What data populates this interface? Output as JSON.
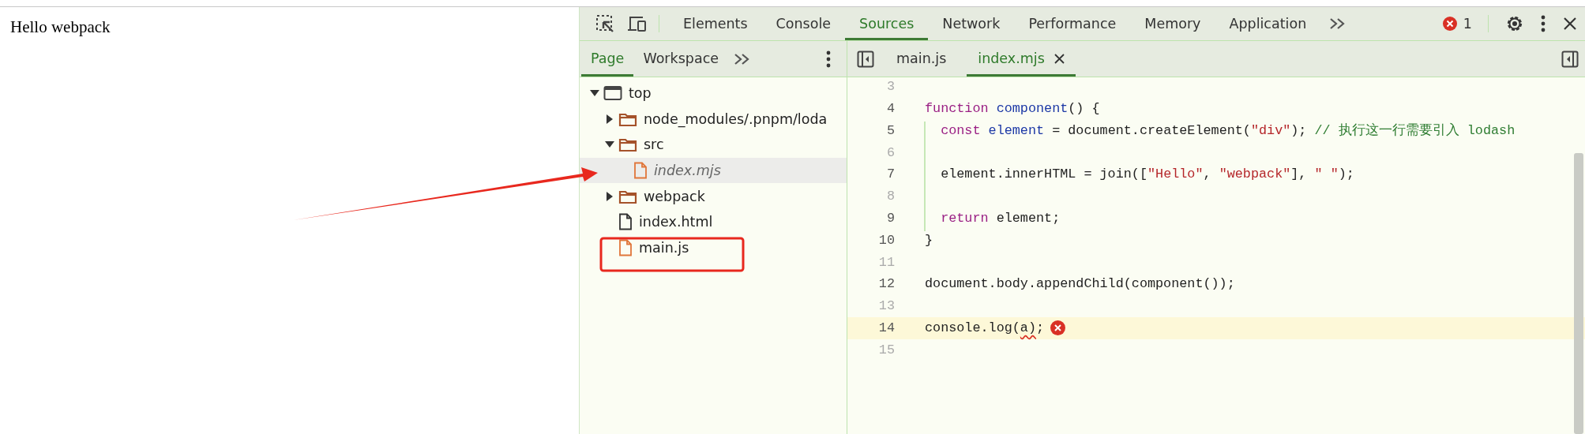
{
  "page": {
    "text": "Hello webpack"
  },
  "devtools": {
    "panel_tabs": [
      {
        "label": "Elements",
        "selected": false
      },
      {
        "label": "Console",
        "selected": false
      },
      {
        "label": "Sources",
        "selected": true
      },
      {
        "label": "Network",
        "selected": false
      },
      {
        "label": "Performance",
        "selected": false
      },
      {
        "label": "Memory",
        "selected": false
      },
      {
        "label": "Application",
        "selected": false
      }
    ],
    "error_count": "1",
    "navigator_tabs": [
      {
        "label": "Page",
        "selected": true
      },
      {
        "label": "Workspace",
        "selected": false
      }
    ],
    "file_tree": [
      {
        "label": "top",
        "kind": "frame",
        "expanded": true,
        "selected": false,
        "children": [
          {
            "label": "node_modules/.pnpm/loda",
            "kind": "folder",
            "expanded": false,
            "selected": false
          },
          {
            "label": "src",
            "kind": "folder",
            "expanded": true,
            "selected": false,
            "children": [
              {
                "label": "index.mjs",
                "kind": "script",
                "selected": true
              }
            ]
          },
          {
            "label": "webpack",
            "kind": "folder",
            "expanded": false,
            "selected": false
          },
          {
            "label": "index.html",
            "kind": "document",
            "selected": false
          },
          {
            "label": "main.js",
            "kind": "script",
            "selected": false
          }
        ]
      }
    ],
    "editor_tabs": [
      {
        "label": "main.js",
        "selected": false,
        "closable": false
      },
      {
        "label": "index.mjs",
        "selected": true,
        "closable": true
      }
    ],
    "code_lines": [
      {
        "number": "3",
        "highlighted": false,
        "error": false
      },
      {
        "number": "4",
        "highlighted": false,
        "error": false,
        "tokens": [
          {
            "kind": "keyword",
            "text": "function "
          },
          {
            "kind": "def",
            "text": "component"
          },
          {
            "kind": "plain",
            "text": "() {"
          }
        ]
      },
      {
        "number": "5",
        "highlighted": false,
        "error": false,
        "tokens": [
          {
            "kind": "keyword",
            "text": "  const "
          },
          {
            "kind": "def",
            "text": "element"
          },
          {
            "kind": "plain",
            "text": " = document.createElement("
          },
          {
            "kind": "string",
            "text": "\"div\""
          },
          {
            "kind": "plain",
            "text": "); "
          },
          {
            "kind": "comment",
            "text": "// 执行这一行需要引入 lodash"
          }
        ]
      },
      {
        "number": "6",
        "highlighted": false,
        "error": false
      },
      {
        "number": "7",
        "highlighted": false,
        "error": false,
        "tokens": [
          {
            "kind": "plain",
            "text": "  element.innerHTML = join(["
          },
          {
            "kind": "string",
            "text": "\"Hello\""
          },
          {
            "kind": "plain",
            "text": ", "
          },
          {
            "kind": "string",
            "text": "\"webpack\""
          },
          {
            "kind": "plain",
            "text": "], "
          },
          {
            "kind": "string",
            "text": "\" \""
          },
          {
            "kind": "plain",
            "text": ");"
          }
        ]
      },
      {
        "number": "8",
        "highlighted": false,
        "error": false
      },
      {
        "number": "9",
        "highlighted": false,
        "error": false,
        "tokens": [
          {
            "kind": "keyword",
            "text": "  return"
          },
          {
            "kind": "plain",
            "text": " element;"
          }
        ]
      },
      {
        "number": "10",
        "highlighted": false,
        "error": false,
        "tokens": [
          {
            "kind": "plain",
            "text": "}"
          }
        ]
      },
      {
        "number": "11",
        "highlighted": false,
        "error": false
      },
      {
        "number": "12",
        "highlighted": false,
        "error": false,
        "tokens": [
          {
            "kind": "plain",
            "text": "document.body.appendChild(component());"
          }
        ]
      },
      {
        "number": "13",
        "highlighted": false,
        "error": false
      },
      {
        "number": "14",
        "highlighted": true,
        "error": true,
        "tokens": [
          {
            "kind": "plain",
            "text": "console.log("
          },
          {
            "kind": "error",
            "text": "a)"
          },
          {
            "kind": "plain",
            "text": ";"
          }
        ]
      },
      {
        "number": "15",
        "highlighted": false,
        "error": false
      }
    ]
  }
}
